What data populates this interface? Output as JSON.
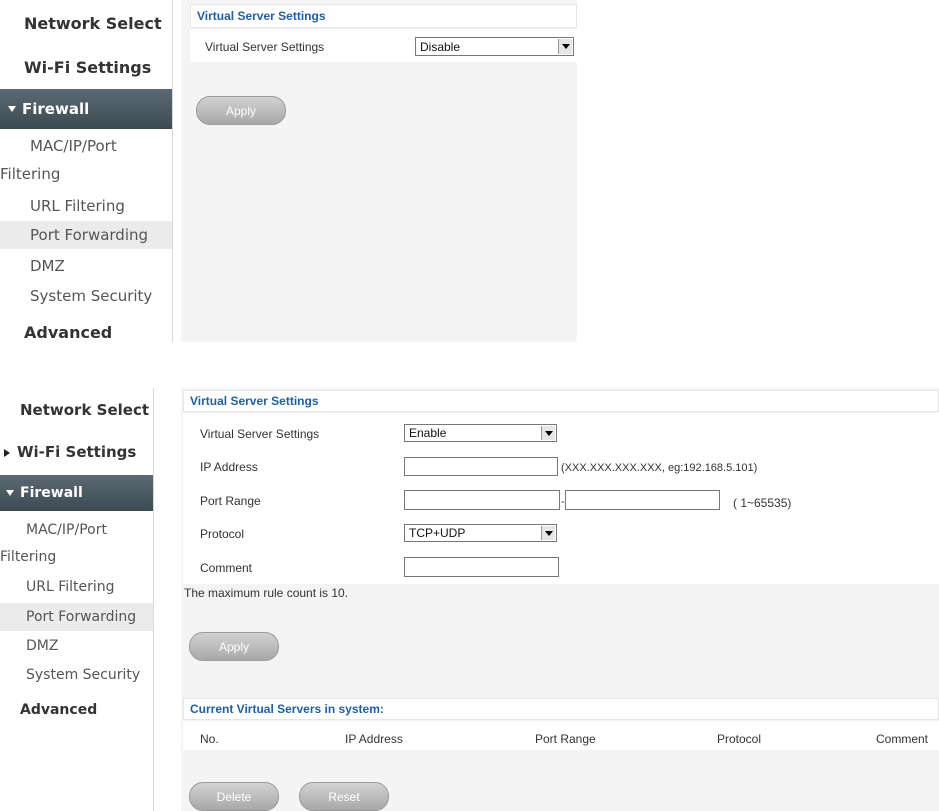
{
  "panel1": {
    "nav": {
      "network_select": "Network Select",
      "wifi_settings": "Wi-Fi Settings",
      "firewall": "Firewall",
      "mac_ip_port_1": "MAC/IP/Port",
      "mac_ip_port_2": "Filtering",
      "url_filtering": "URL Filtering",
      "port_forwarding": "Port Forwarding",
      "dmz": "DMZ",
      "system_security": "System Security",
      "advanced": "Advanced"
    },
    "section_title": "Virtual Server Settings",
    "vs_label": "Virtual Server Settings",
    "vs_value": "Disable",
    "apply": "Apply"
  },
  "panel2": {
    "nav": {
      "network_select": "Network Select",
      "wifi_settings": "Wi-Fi Settings",
      "firewall": "Firewall",
      "mac_ip_port_1": "MAC/IP/Port",
      "mac_ip_port_2": "Filtering",
      "url_filtering": "URL Filtering",
      "port_forwarding": "Port Forwarding",
      "dmz": "DMZ",
      "system_security": "System Security",
      "advanced": "Advanced"
    },
    "section_title": "Virtual Server Settings",
    "vs_label": "Virtual Server Settings",
    "vs_value": "Enable",
    "ip_label": "IP Address",
    "ip_hint": "(XXX.XXX.XXX.XXX, eg:192.168.5.101)",
    "ip_value": "",
    "port_label": "Port Range",
    "port_from": "",
    "port_sep": "-",
    "port_to": "",
    "port_hint": "( 1~65535)",
    "protocol_label": "Protocol",
    "protocol_value": "TCP+UDP",
    "comment_label": "Comment",
    "comment_value": "",
    "max_rule_note": "The maximum rule count is 10.",
    "apply": "Apply",
    "current_title": "Current Virtual Servers in system:",
    "columns": [
      "No.",
      "IP Address",
      "Port Range",
      "Protocol",
      "Comment"
    ],
    "delete": "Delete",
    "reset": "Reset"
  }
}
